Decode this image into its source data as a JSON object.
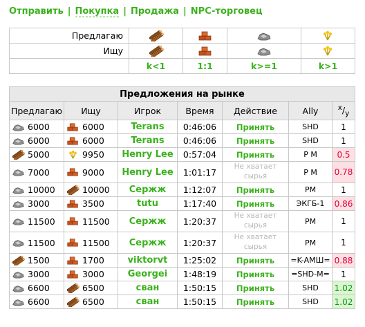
{
  "nav": [
    {
      "label": "Отправить",
      "active": false
    },
    {
      "label": "Покупка",
      "active": true
    },
    {
      "label": "Продажа",
      "active": false
    },
    {
      "label": "NPC-торговец",
      "active": false
    }
  ],
  "offer_table": {
    "give_label": "Предлагаю",
    "want_label": "Ищу",
    "icons": [
      "wood-icon",
      "clay-icon",
      "iron-icon",
      "crop-icon"
    ],
    "ratio_labels": [
      "k<1",
      "1:1",
      "k>=1",
      "k>1"
    ]
  },
  "market": {
    "title": "Предложения на рынке",
    "headers": [
      "Предлагаю",
      "Ищу",
      "Игрок",
      "Время",
      "Действие",
      "Ally",
      "x/y"
    ],
    "rows": [
      {
        "give_icon": "iron",
        "give": "6000",
        "want_icon": "clay",
        "want": "6000",
        "player": "Terans",
        "time": "0:46:06",
        "action": "Принять",
        "ok": true,
        "ally": "SHD",
        "ratio": "1",
        "rclass": ""
      },
      {
        "give_icon": "iron",
        "give": "6000",
        "want_icon": "clay",
        "want": "6000",
        "player": "Terans",
        "time": "0:46:06",
        "action": "Принять",
        "ok": true,
        "ally": "SHD",
        "ratio": "1",
        "rclass": ""
      },
      {
        "give_icon": "wood",
        "give": "5000",
        "want_icon": "crop",
        "want": "9950",
        "player": "Henry Lee",
        "time": "0:57:04",
        "action": "Принять",
        "ok": true,
        "ally": "P M",
        "ratio": "0.5",
        "rclass": "red"
      },
      {
        "give_icon": "iron",
        "give": "7000",
        "want_icon": "clay",
        "want": "9000",
        "player": "Henry Lee",
        "time": "1:01:17",
        "action": "Не хватает сырья",
        "ok": false,
        "ally": "P M",
        "ratio": "0.78",
        "rclass": "red"
      },
      {
        "give_icon": "iron",
        "give": "10000",
        "want_icon": "wood",
        "want": "10000",
        "player": "Сержж",
        "time": "1:12:07",
        "action": "Принять",
        "ok": true,
        "ally": "PM",
        "ratio": "1",
        "rclass": ""
      },
      {
        "give_icon": "iron",
        "give": "3000",
        "want_icon": "clay",
        "want": "3500",
        "player": "tutu",
        "time": "1:17:40",
        "action": "Принять",
        "ok": true,
        "ally": "ЭКГБ-1",
        "ratio": "0.86",
        "rclass": "red"
      },
      {
        "give_icon": "iron",
        "give": "11500",
        "want_icon": "clay",
        "want": "11500",
        "player": "Сержж",
        "time": "1:20:37",
        "action": "Не хватает сырья",
        "ok": false,
        "ally": "PM",
        "ratio": "1",
        "rclass": ""
      },
      {
        "give_icon": "iron",
        "give": "11500",
        "want_icon": "clay",
        "want": "11500",
        "player": "Сержж",
        "time": "1:20:37",
        "action": "Не хватает сырья",
        "ok": false,
        "ally": "PM",
        "ratio": "1",
        "rclass": ""
      },
      {
        "give_icon": "wood",
        "give": "1500",
        "want_icon": "clay",
        "want": "1700",
        "player": "viktorvt",
        "time": "1:25:02",
        "action": "Принять",
        "ok": true,
        "ally": "=K-АМШ=",
        "ratio": "0.88",
        "rclass": "red"
      },
      {
        "give_icon": "iron",
        "give": "3000",
        "want_icon": "clay",
        "want": "3000",
        "player": "Georgei",
        "time": "1:48:19",
        "action": "Принять",
        "ok": true,
        "ally": "=SHD-M=",
        "ratio": "1",
        "rclass": ""
      },
      {
        "give_icon": "iron",
        "give": "6600",
        "want_icon": "wood",
        "want": "6500",
        "player": "сван",
        "time": "1:50:15",
        "action": "Принять",
        "ok": true,
        "ally": "SHD",
        "ratio": "1.02",
        "rclass": "grn"
      },
      {
        "give_icon": "iron",
        "give": "6600",
        "want_icon": "wood",
        "want": "6500",
        "player": "сван",
        "time": "1:50:15",
        "action": "Принять",
        "ok": true,
        "ally": "SHD",
        "ratio": "1.02",
        "rclass": "grn"
      }
    ]
  }
}
